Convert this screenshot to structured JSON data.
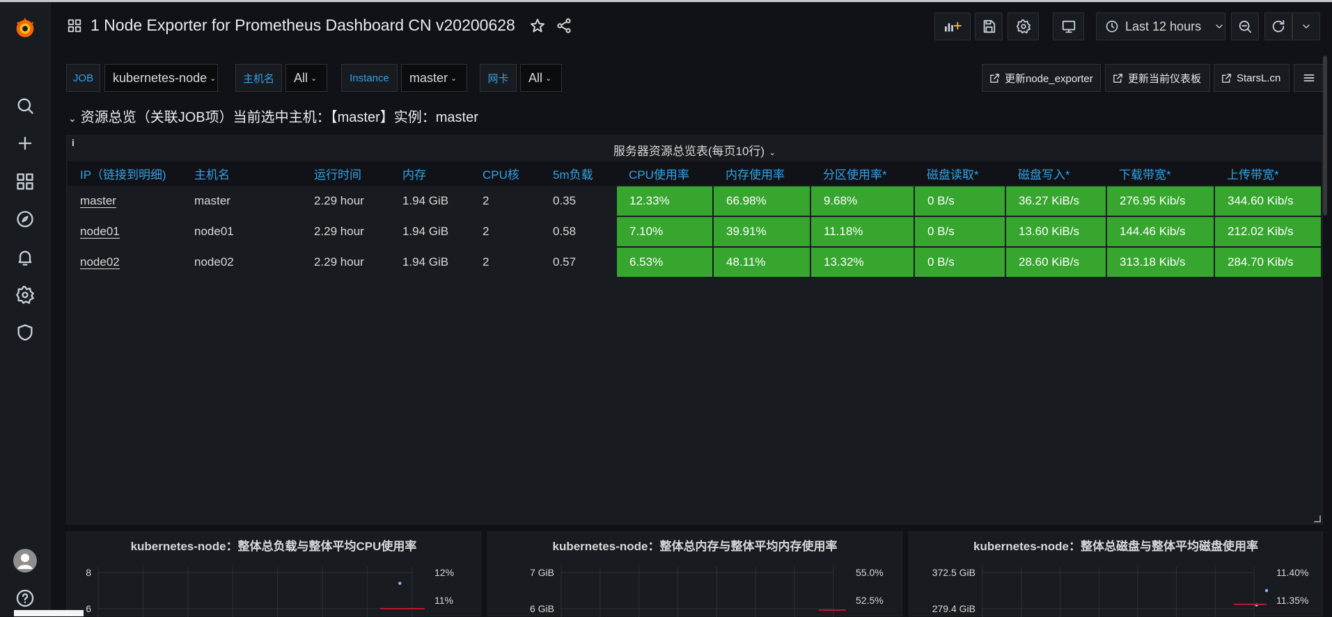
{
  "colors": {
    "accent": "#33a2e5",
    "ok_cell": "#37a62f",
    "threshold_line": "#c4162a",
    "point": "#8ab8ff",
    "bg": "#111217",
    "panel": "#181b1f"
  },
  "sidebar": {
    "logo": "grafana-logo",
    "items": [
      "search-icon",
      "plus-icon",
      "dashboards-icon",
      "explore-icon",
      "alerting-icon",
      "configuration-icon",
      "server-admin-icon"
    ],
    "bottom": [
      "avatar",
      "help-icon"
    ]
  },
  "header": {
    "title": "1 Node Exporter for Prometheus Dashboard CN v20200628",
    "time_range": "Last 12 hours"
  },
  "variables": [
    {
      "label": "JOB",
      "value": "kubernetes-node"
    },
    {
      "label": "主机名",
      "value": "All"
    },
    {
      "label": "Instance",
      "value": "master"
    },
    {
      "label": "网卡",
      "value": "All"
    }
  ],
  "links": [
    "更新node_exporter",
    "更新当前仪表板",
    "StarsL.cn"
  ],
  "row_title": "资源总览（关联JOB项）当前选中主机：【master】实例：master",
  "table_panel": {
    "title": "服务器资源总览表(每页10行)",
    "columns": [
      "IP（链接到明细)",
      "主机名",
      "运行时间",
      "内存",
      "CPU核",
      "5m负载",
      "CPU使用率",
      "内存使用率",
      "分区使用率*",
      "磁盘读取*",
      "磁盘写入*",
      "下载带宽*",
      "上传带宽*"
    ],
    "rows": [
      [
        "master",
        "master",
        "2.29 hour",
        "1.94 GiB",
        "2",
        "0.35",
        "12.33%",
        "66.98%",
        "9.68%",
        "0 B/s",
        "36.27 KiB/s",
        "276.95 Kib/s",
        "344.60 Kib/s"
      ],
      [
        "node01",
        "node01",
        "2.29 hour",
        "1.94 GiB",
        "2",
        "0.58",
        "7.10%",
        "39.91%",
        "11.18%",
        "0 B/s",
        "13.60 KiB/s",
        "144.46 Kib/s",
        "212.02 Kib/s"
      ],
      [
        "node02",
        "node02",
        "2.29 hour",
        "1.94 GiB",
        "2",
        "0.57",
        "6.53%",
        "48.11%",
        "13.32%",
        "0 B/s",
        "28.60 KiB/s",
        "313.18 Kib/s",
        "284.70 Kib/s"
      ]
    ]
  },
  "chart_data": [
    {
      "type": "line",
      "title": "kubernetes-node：整体总负载与整体平均CPU使用率",
      "y_ticks": [
        "8",
        "6"
      ],
      "y2_ticks": [
        "12%",
        "11%"
      ],
      "ylim": [
        4,
        8
      ],
      "y2lim": [
        10,
        12
      ],
      "series": [
        {
          "values": [
            {
              "x": 0.92,
              "y": 11.7
            }
          ],
          "axis": "right",
          "kind": "points"
        },
        {
          "values": [
            {
              "x": 0.86,
              "y": 6.0
            },
            {
              "x": 1.0,
              "y": 6.0
            }
          ],
          "axis": "left",
          "kind": "line"
        }
      ]
    },
    {
      "type": "line",
      "title": "kubernetes-node：整体总内存与整体平均内存使用率",
      "y_ticks": [
        "7 GiB",
        "6 GiB"
      ],
      "y2_ticks": [
        "55.0%",
        "52.5%"
      ],
      "ylim": [
        5,
        7
      ],
      "y2lim": [
        50,
        55
      ],
      "series": [
        {
          "values": [
            {
              "x": 0.96,
              "y": 51.2
            },
            {
              "x": 0.99,
              "y": 51.8
            }
          ],
          "axis": "right",
          "kind": "points"
        },
        {
          "values": [
            {
              "x": 0.9,
              "y": 52.4
            },
            {
              "x": 1.0,
              "y": 52.4
            }
          ],
          "axis": "right",
          "kind": "line"
        }
      ]
    },
    {
      "type": "line",
      "title": "kubernetes-node：整体总磁盘与整体平均磁盘使用率",
      "y_ticks": [
        "372.5 GiB",
        "279.4 GiB"
      ],
      "y2_ticks": [
        "11.40%",
        "11.35%"
      ],
      "ylim": [
        186.2,
        372.5
      ],
      "y2lim": [
        11.3,
        11.4
      ],
      "series": [
        {
          "values": [
            {
              "x": 0.96,
              "y": 11.355
            },
            {
              "x": 1.0,
              "y": 11.375
            }
          ],
          "axis": "right",
          "kind": "points"
        },
        {
          "values": [
            {
              "x": 0.88,
              "y": 11.356
            },
            {
              "x": 1.0,
              "y": 11.356
            }
          ],
          "axis": "right",
          "kind": "line"
        }
      ]
    }
  ]
}
